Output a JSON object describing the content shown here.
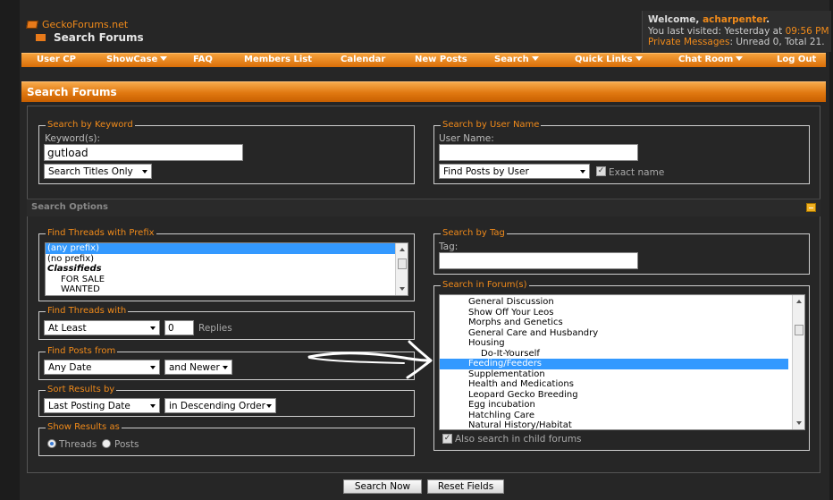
{
  "header": {
    "site_name": "GeckoForums.net",
    "page_heading": "Search Forums",
    "welcome_prefix": "Welcome, ",
    "username": "acharpenter",
    "welcome_suffix": ".",
    "last_visited_prefix": "You last visited: Yesterday at ",
    "last_visited_time": "09:56 PM",
    "pm_label": "Private Messages",
    "pm_status": ": Unread 0, Total 21."
  },
  "navbar": {
    "items": [
      {
        "label": "User CP",
        "has_menu": false
      },
      {
        "label": "ShowCase",
        "has_menu": true
      },
      {
        "label": "FAQ",
        "has_menu": false
      },
      {
        "label": "Members List",
        "has_menu": false
      },
      {
        "label": "Calendar",
        "has_menu": false
      },
      {
        "label": "New Posts",
        "has_menu": false
      },
      {
        "label": "Search",
        "has_menu": true
      },
      {
        "label": "Quick Links",
        "has_menu": true
      },
      {
        "label": "Chat Room",
        "has_menu": true
      },
      {
        "label": "Log Out",
        "has_menu": false
      }
    ]
  },
  "section_title": "Search Forums",
  "keyword": {
    "legend": "Search by Keyword",
    "label": "Keyword(s):",
    "value": "gutload",
    "mode": "Search Titles Only"
  },
  "username_search": {
    "legend": "Search by User Name",
    "label": "User Name:",
    "value": "",
    "mode": "Find Posts by User",
    "exact_label": "Exact name",
    "exact_checked": true
  },
  "options_title": "Search Options",
  "prefix": {
    "legend": "Find Threads with Prefix",
    "items": [
      {
        "label": "(any prefix)",
        "selected": true,
        "style": "normal"
      },
      {
        "label": "(no prefix)",
        "selected": false,
        "style": "normal"
      },
      {
        "label": "Classifieds",
        "selected": false,
        "style": "group"
      },
      {
        "label": "FOR SALE",
        "selected": false,
        "style": "indent"
      },
      {
        "label": "WANTED",
        "selected": false,
        "style": "indent"
      }
    ]
  },
  "threads_with": {
    "legend": "Find Threads with",
    "mode": "At Least",
    "count": "0",
    "suffix": "Replies"
  },
  "posts_from": {
    "legend": "Find Posts from",
    "date": "Any Date",
    "direction": "and Newer"
  },
  "sort": {
    "legend": "Sort Results by",
    "field": "Last Posting Date",
    "order": "in Descending Order"
  },
  "show_as": {
    "legend": "Show Results as",
    "threads_label": "Threads",
    "posts_label": "Posts",
    "selected": "threads"
  },
  "tag": {
    "legend": "Search by Tag",
    "label": "Tag:",
    "value": ""
  },
  "forums": {
    "legend": "Search in Forum(s)",
    "items": [
      {
        "label": "General Discussion",
        "selected": false,
        "indent": 1
      },
      {
        "label": "Show Off Your Leos",
        "selected": false,
        "indent": 1
      },
      {
        "label": "Morphs and Genetics",
        "selected": false,
        "indent": 1
      },
      {
        "label": "General Care and Husbandry",
        "selected": false,
        "indent": 1
      },
      {
        "label": "Housing",
        "selected": false,
        "indent": 1
      },
      {
        "label": "Do-It-Yourself",
        "selected": false,
        "indent": 2
      },
      {
        "label": "Feeding/Feeders",
        "selected": true,
        "indent": 1
      },
      {
        "label": "Supplementation",
        "selected": false,
        "indent": 1
      },
      {
        "label": "Health and Medications",
        "selected": false,
        "indent": 1
      },
      {
        "label": "Leopard Gecko Breeding",
        "selected": false,
        "indent": 1
      },
      {
        "label": "Egg incubation",
        "selected": false,
        "indent": 1
      },
      {
        "label": "Hatchling Care",
        "selected": false,
        "indent": 1
      },
      {
        "label": "Natural History/Habitat",
        "selected": false,
        "indent": 1
      }
    ],
    "child_label": "Also search in child forums",
    "child_checked": true
  },
  "buttons": {
    "search": "Search Now",
    "reset": "Reset Fields"
  }
}
